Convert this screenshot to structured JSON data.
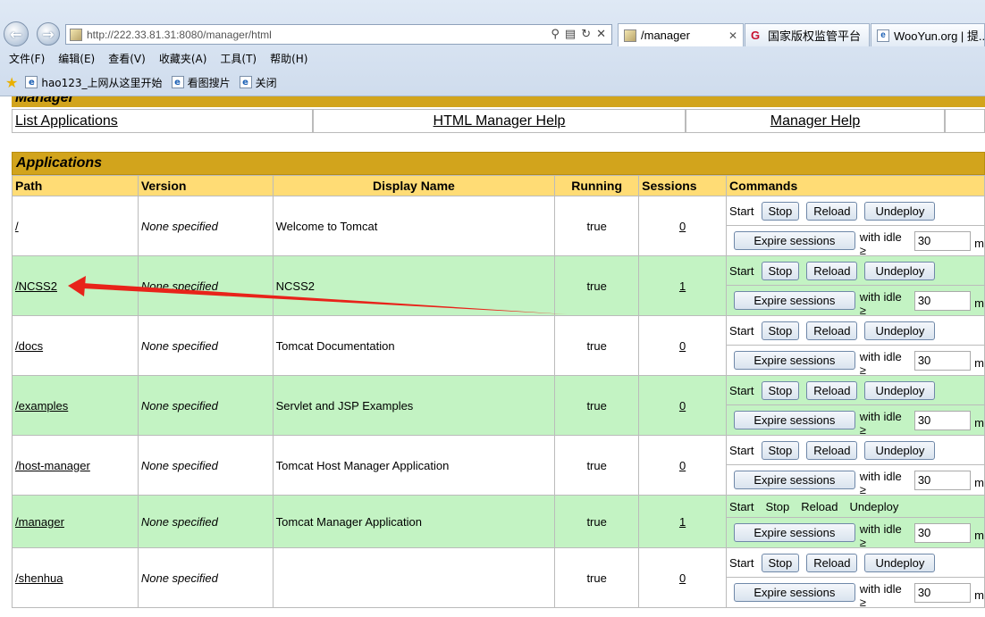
{
  "browser": {
    "url": "http://222.33.81.31:8080/manager/html",
    "tabs": [
      {
        "label": "/manager",
        "close": "✕"
      },
      {
        "label": "国家版权监管平台"
      },
      {
        "label": "WooYun.org | 提..."
      }
    ],
    "menu": [
      "文件(F)",
      "编辑(E)",
      "查看(V)",
      "收藏夹(A)",
      "工具(T)",
      "帮助(H)"
    ],
    "favorites": [
      "hao123_上网从这里开始",
      "看图搜片",
      "关闭"
    ],
    "icons": [
      "back-icon",
      "forward-icon",
      "search-icon",
      "compat-icon",
      "refresh-icon",
      "stop-icon",
      "star-icon"
    ]
  },
  "manager": {
    "header": "Manager",
    "links": [
      "List Applications",
      "HTML Manager Help",
      "Manager Help"
    ]
  },
  "applications": {
    "title": "Applications",
    "columns": [
      "Path",
      "Version",
      "Display Name",
      "Running",
      "Sessions",
      "Commands"
    ],
    "rows": [
      {
        "path": "/",
        "version": "None specified",
        "display_name": "Welcome to Tomcat",
        "running": "true",
        "sessions": "0"
      },
      {
        "path": "/NCSS2",
        "version": "None specified",
        "display_name": "NCSS2",
        "running": "true",
        "sessions": "1"
      },
      {
        "path": "/docs",
        "version": "None specified",
        "display_name": "Tomcat Documentation",
        "running": "true",
        "sessions": "0"
      },
      {
        "path": "/examples",
        "version": "None specified",
        "display_name": "Servlet and JSP Examples",
        "running": "true",
        "sessions": "0"
      },
      {
        "path": "/host-manager",
        "version": "None specified",
        "display_name": "Tomcat Host Manager Application",
        "running": "true",
        "sessions": "0"
      },
      {
        "path": "/manager",
        "version": "None specified",
        "display_name": "Tomcat Manager Application",
        "running": "true",
        "sessions": "1"
      },
      {
        "path": "/shenhua",
        "version": "None specified",
        "display_name": "",
        "running": "true",
        "sessions": "0"
      }
    ],
    "commands": {
      "start": "Start",
      "stop": "Stop",
      "reload": "Reload",
      "undeploy": "Undeploy",
      "expire": "Expire sessions",
      "idle_label": "with idle ≥",
      "idle_value": "30",
      "suffix": "m"
    }
  },
  "annotation": {
    "color": "#e8231a"
  }
}
